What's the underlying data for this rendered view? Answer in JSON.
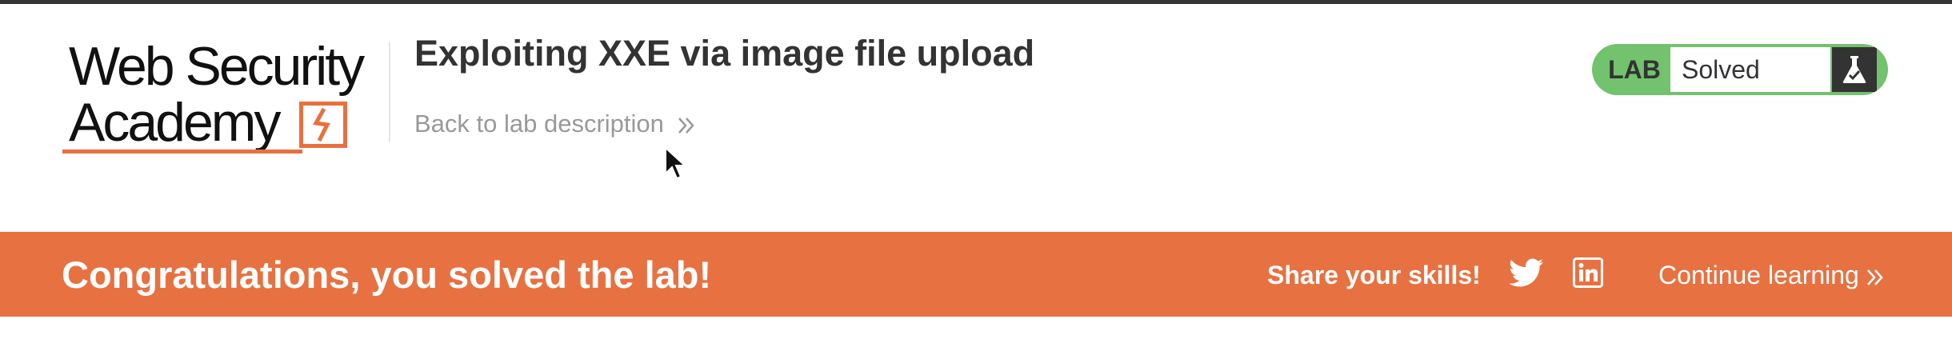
{
  "logo": {
    "line1": "Web Security",
    "line2": "Academy",
    "accent_color": "#e8703f"
  },
  "header": {
    "lab_title": "Exploiting XXE via image file upload",
    "back_link": "Back to lab description",
    "back_link_icon": "double-chevron-right-icon"
  },
  "lab_badge": {
    "label": "LAB",
    "status": "Solved",
    "icon": "flask-icon",
    "color": "#73c26e"
  },
  "banner": {
    "message": "Congratulations, you solved the lab!",
    "share_label": "Share your skills!",
    "share_icons": [
      "twitter-icon",
      "linkedin-icon"
    ],
    "continue_label": "Continue learning",
    "color": "#e87141"
  }
}
